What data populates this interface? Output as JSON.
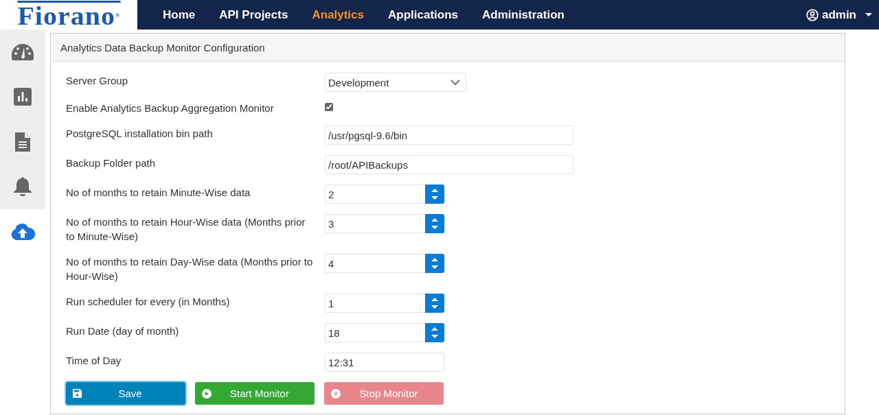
{
  "nav": {
    "logo": "Fiorano",
    "logo_mark": "®",
    "items": [
      {
        "label": "Home",
        "selected": false
      },
      {
        "label": "API Projects",
        "selected": false
      },
      {
        "label": "Analytics",
        "selected": true
      },
      {
        "label": "Applications",
        "selected": false
      },
      {
        "label": "Administration",
        "selected": false
      }
    ],
    "user": "admin"
  },
  "sidebar": [
    {
      "selected": false
    },
    {
      "selected": false
    },
    {
      "selected": false
    },
    {
      "selected": false
    },
    {
      "selected": true
    }
  ],
  "panel": {
    "title": "Analytics Data Backup Monitor Configuration",
    "fields": [
      {
        "kind": "select",
        "label": "Server Group",
        "value": "Development"
      },
      {
        "kind": "checkbox",
        "label": "Enable Analytics Backup Aggregation Monitor",
        "checked": true
      },
      {
        "kind": "text",
        "label": "PostgreSQL installation bin path",
        "value": "/usr/pgsql-9.6/bin"
      },
      {
        "kind": "text",
        "label": "Backup Folder path",
        "value": "/root/APIBackups"
      },
      {
        "kind": "number",
        "label": "No of months to retain Minute-Wise data",
        "value": "2"
      },
      {
        "kind": "number",
        "label": "No of months to retain Hour-Wise data (Months prior to Minute-Wise)",
        "value": "3"
      },
      {
        "kind": "number",
        "label": "No of months to retain Day-Wise data (Months prior to Hour-Wise)",
        "value": "4"
      },
      {
        "kind": "number",
        "label": "Run scheduler for every (in Months)",
        "value": "1"
      },
      {
        "kind": "number",
        "label": "Run Date (day of month)",
        "value": "18"
      },
      {
        "kind": "time",
        "label": "Time of Day",
        "value": "12:31"
      }
    ],
    "buttons": [
      {
        "kind": "save",
        "label": "Save",
        "disabled": false,
        "focused": true
      },
      {
        "kind": "start",
        "label": "Start Monitor",
        "disabled": false,
        "focused": false
      },
      {
        "kind": "stop",
        "label": "Stop Monitor",
        "disabled": true,
        "focused": false
      }
    ]
  }
}
